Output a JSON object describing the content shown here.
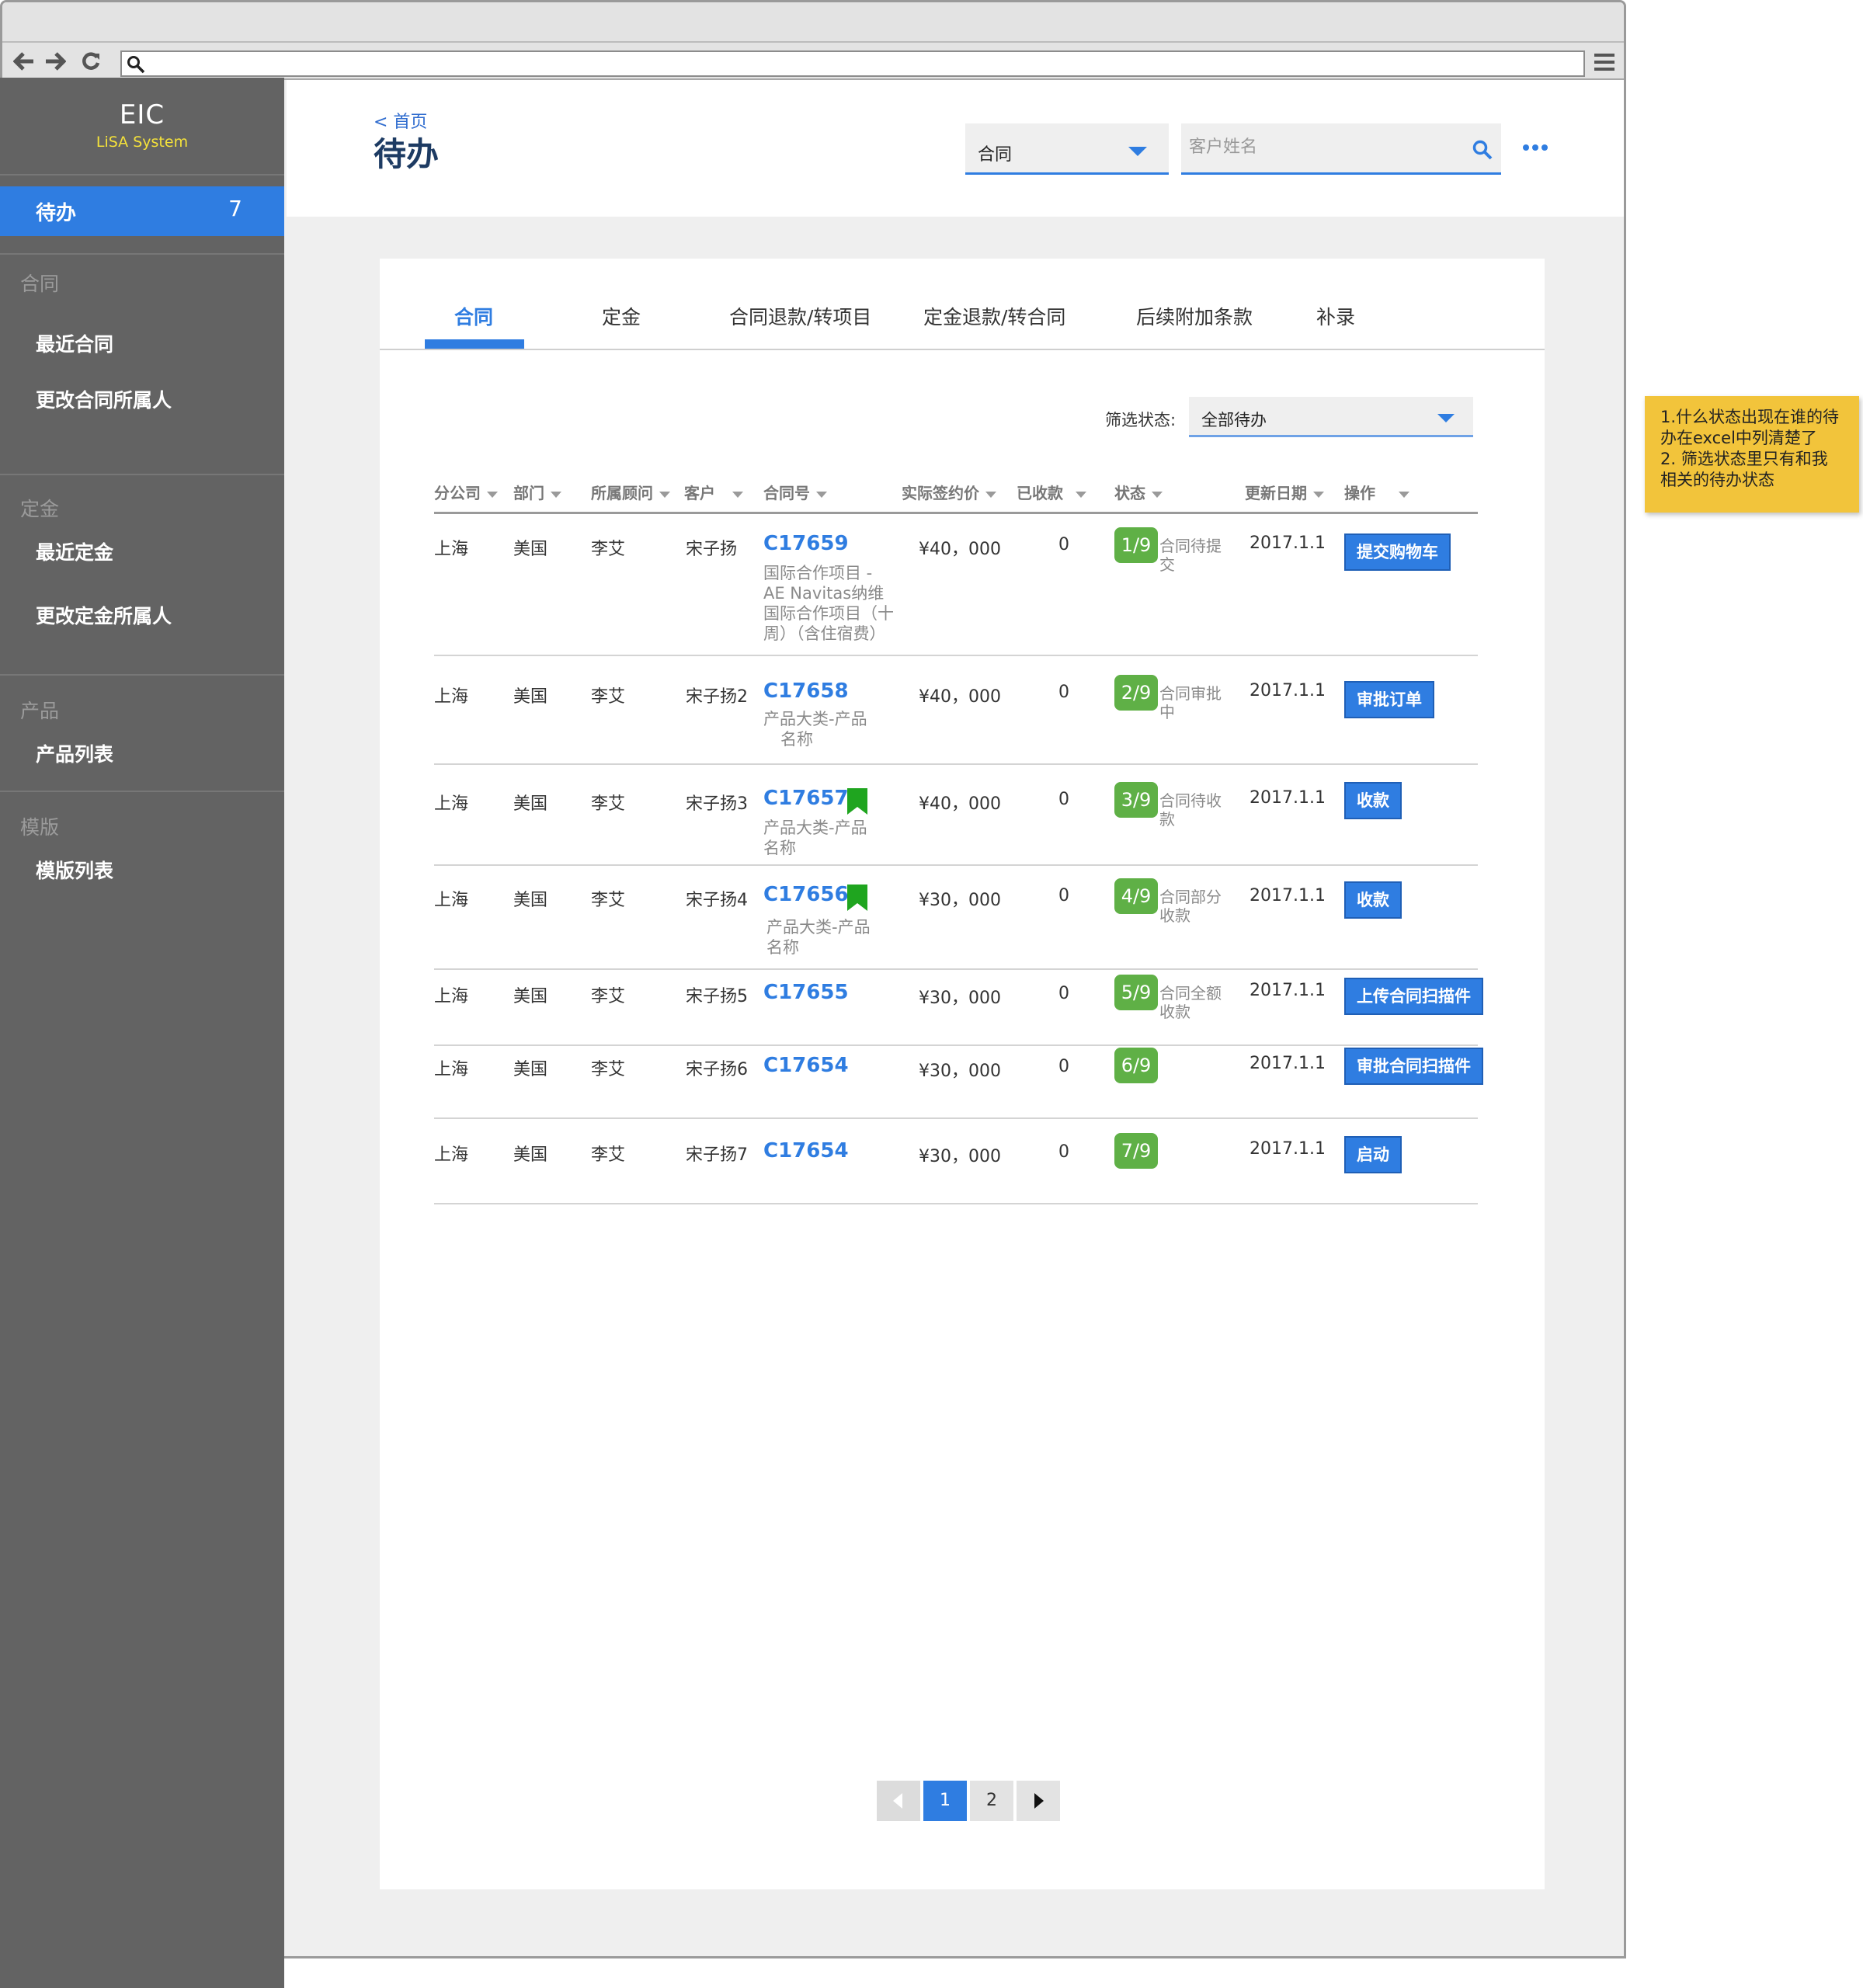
{
  "app": {
    "logo_title": "EIC",
    "logo_subtitle": "LiSA System"
  },
  "sidebar": {
    "active": {
      "label": "待办",
      "count": "7"
    },
    "sections": [
      {
        "title": "合同",
        "items": [
          "最近合同",
          "更改合同所属人"
        ]
      },
      {
        "title": "定金",
        "items": [
          "最近定金",
          "更改定金所属人"
        ]
      },
      {
        "title": "产品",
        "items": [
          "产品列表"
        ]
      },
      {
        "title": "模版",
        "items": [
          "模版列表"
        ]
      }
    ]
  },
  "header": {
    "breadcrumb": "< 首页",
    "title": "待办",
    "type_select": "合同",
    "search_placeholder": "客户姓名"
  },
  "tabs": [
    "合同",
    "定金",
    "合同退款/转项目",
    "定金退款/转合同",
    "后续附加条款",
    "补录"
  ],
  "filter": {
    "label": "筛选状态:",
    "value": "全部待办"
  },
  "table": {
    "columns": [
      "分公司",
      "部门",
      "所属顾问",
      "客户",
      "合同号",
      "实际签约价",
      "已收款",
      "状态",
      "更新日期",
      "操作"
    ],
    "rows": [
      {
        "branch": "上海",
        "dept": "美国",
        "advisor": "李艾",
        "client": "宋子扬",
        "contract": "C17659",
        "flag": false,
        "sub": [
          "国际合作项目 -",
          "AE Navitas纳维",
          "国际合作项目（十",
          "周）（含住宿费）"
        ],
        "price": "¥40，000",
        "received": "0",
        "step": "1/9",
        "status": [
          "合同待提",
          "交"
        ],
        "date": "2017.1.1",
        "action": "提交购物车"
      },
      {
        "branch": "上海",
        "dept": "美国",
        "advisor": "李艾",
        "client": "宋子扬2",
        "contract": "C17658",
        "flag": false,
        "sub": [
          "产品大类-产品",
          "名称"
        ],
        "price": "¥40，000",
        "received": "0",
        "step": "2/9",
        "status": [
          "合同审批",
          "中"
        ],
        "date": "2017.1.1",
        "action": "审批订单"
      },
      {
        "branch": "上海",
        "dept": "美国",
        "advisor": "李艾",
        "client": "宋子扬3",
        "contract": "C17657",
        "flag": true,
        "sub": [
          "产品大类-产品",
          "名称"
        ],
        "price": "¥40，000",
        "received": "0",
        "step": "3/9",
        "status": [
          "合同待收",
          "款"
        ],
        "date": "2017.1.1",
        "action": "收款"
      },
      {
        "branch": "上海",
        "dept": "美国",
        "advisor": "李艾",
        "client": "宋子扬4",
        "contract": "C17656",
        "flag": true,
        "sub": [
          "产品大类-产品",
          "名称"
        ],
        "price": "¥30，000",
        "received": "0",
        "step": "4/9",
        "status": [
          "合同部分",
          "收款"
        ],
        "date": "2017.1.1",
        "action": "收款"
      },
      {
        "branch": "上海",
        "dept": "美国",
        "advisor": "李艾",
        "client": "宋子扬5",
        "contract": "C17655",
        "flag": false,
        "sub": [],
        "price": "¥30，000",
        "received": "0",
        "step": "5/9",
        "status": [
          "合同全额",
          "收款"
        ],
        "date": "2017.1.1",
        "action": "上传合同扫描件"
      },
      {
        "branch": "上海",
        "dept": "美国",
        "advisor": "李艾",
        "client": "宋子扬6",
        "contract": "C17654",
        "flag": false,
        "sub": [],
        "price": "¥30，000",
        "received": "0",
        "step": "6/9",
        "status": [],
        "date": "2017.1.1",
        "action": "审批合同扫描件"
      },
      {
        "branch": "上海",
        "dept": "美国",
        "advisor": "李艾",
        "client": "宋子扬7",
        "contract": "C17654",
        "flag": false,
        "sub": [],
        "price": "¥30，000",
        "received": "0",
        "step": "7/9",
        "status": [],
        "date": "2017.1.1",
        "action": "启动"
      }
    ]
  },
  "pagination": {
    "pages": [
      "1",
      "2"
    ],
    "current": "1"
  },
  "sticky_note": [
    "1.什么状态出现在谁的待",
    "办在excel中列清楚了",
    "2. 筛选状态里只有和我",
    "相关的待办状态"
  ],
  "colors": {
    "accent": "#2f7de1",
    "sidebar": "#636363",
    "step_badge": "#5fb046",
    "sticky": "#f2c43b"
  },
  "icons": [
    "back-arrow-icon",
    "forward-arrow-icon",
    "reload-icon",
    "search-icon",
    "hamburger-menu-icon",
    "more-icon",
    "bookmark-flag-icon",
    "caret-down-icon"
  ]
}
